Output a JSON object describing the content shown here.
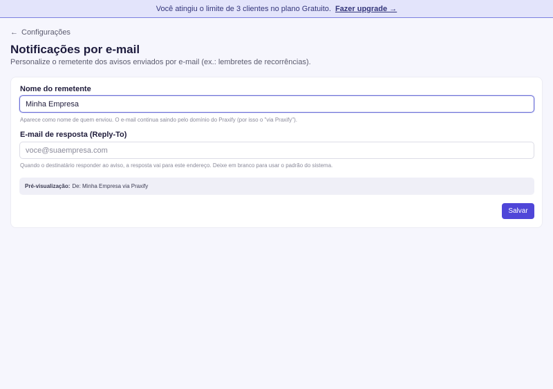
{
  "banner": {
    "message": "Você atingiu o limite de 3 clientes no plano Gratuito.",
    "upgrade_label": "Fazer upgrade →"
  },
  "nav": {
    "back_icon": "←",
    "back_label": "Configurações"
  },
  "page": {
    "title": "Notificações por e-mail",
    "subtitle": "Personalize o remetente dos avisos enviados por e-mail (ex.: lembretes de recorrências)."
  },
  "form": {
    "sender_name": {
      "label": "Nome do remetente",
      "value": "Minha Empresa",
      "help": "Aparece como nome de quem enviou. O e-mail continua saindo pelo domínio do Praxify (por isso o \"via Praxify\")."
    },
    "reply_to": {
      "label": "E-mail de resposta (Reply-To)",
      "value": "",
      "placeholder": "voce@suaempresa.com",
      "help": "Quando o destinatário responder ao aviso, a resposta vai para este endereço. Deixe em branco para usar o padrão do sistema."
    },
    "preview": {
      "label": "Pré-visualização:",
      "value": "De: Minha Empresa via Praxify"
    },
    "save_label": "Salvar"
  },
  "colors": {
    "accent": "#4f46d8",
    "banner_bg": "#e3e4fb",
    "page_bg": "#f6f6fd"
  }
}
